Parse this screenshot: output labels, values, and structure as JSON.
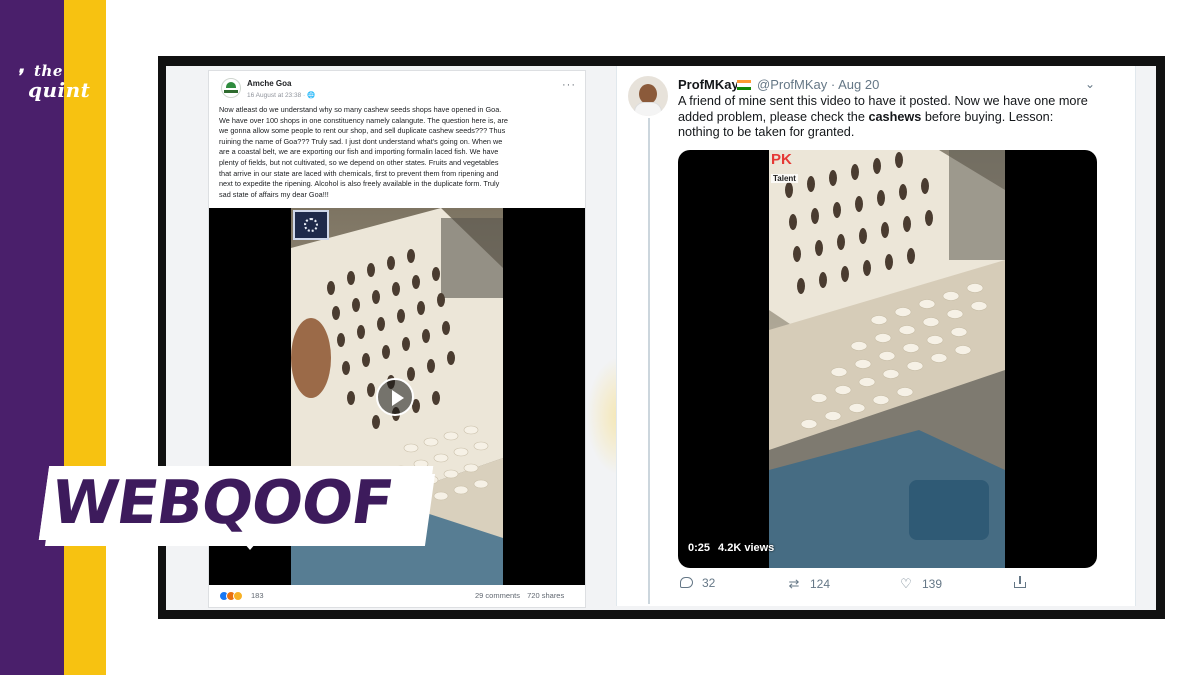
{
  "brand": {
    "logo_line1": "the",
    "logo_line2": "quint",
    "colors": {
      "purple": "#4a1f6b",
      "yellow": "#f7c211"
    }
  },
  "banner": {
    "label": "WEBQOOF"
  },
  "facebook_post": {
    "page_name": "Amche Goa",
    "timestamp": "16 August at 23:38 · ",
    "more_label": "···",
    "text_lines": [
      "Now atleast do we understand why so many cashew seeds shops have opened in Goa.",
      "We have over 100 shops in one constituency namely calangute. The question here is, are",
      "we gonna allow some people to rent our shop, and sell duplicate cashew seeds??? Thus",
      "ruining the name of Goa??? Truly sad. I just dont understand what's going on. When we",
      "are a coastal belt, we are exporting our fish and importing formalin laced fish. We have",
      "plenty of fields, but not cultivated, so we depend on other states. Fruits and vegetables",
      "that arrive in our state are laced with chemicals, first to prevent them from ripening and",
      "next to expedite the ripening. Alcohol is also freely available in the duplicate form. Truly",
      "sad state of affairs my dear Goa!!!"
    ],
    "reaction_count": "183",
    "comments": "29 comments",
    "shares": "720 shares"
  },
  "tweet": {
    "display_name": "ProfMKay",
    "handle_date": "@ProfMKay · Aug 20",
    "text_line1": "A friend of mine sent this video to have it posted. Now we have one more",
    "text_line2_pre": "added problem, please check the ",
    "text_line2_bold": "cashews",
    "text_line2_post": " before buying. Lesson:",
    "text_line3": "nothing to be taken for granted.",
    "watermark_pk": "PK",
    "watermark_talent": "Talent",
    "video_duration": "0:25",
    "video_views": "4.2K views",
    "replies": "32",
    "retweets": "124",
    "likes": "139",
    "icons": [
      "reply-icon",
      "retweet-icon",
      "heart-icon",
      "share-icon"
    ]
  }
}
